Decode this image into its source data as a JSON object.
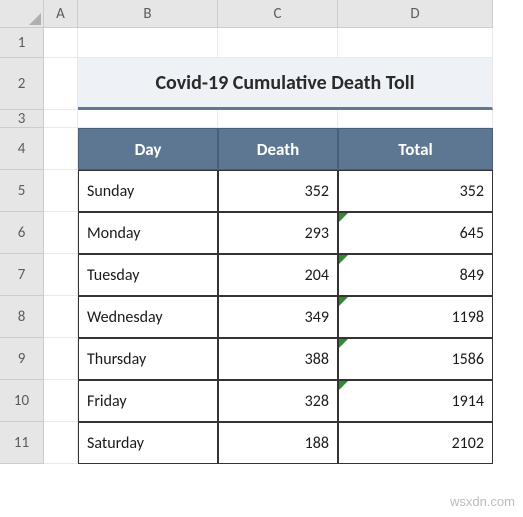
{
  "columns": [
    "",
    "A",
    "B",
    "C",
    "D"
  ],
  "rows": [
    "1",
    "2",
    "3",
    "4",
    "5",
    "6",
    "7",
    "8",
    "9",
    "10",
    "11"
  ],
  "title": "Covid-19 Cumulative Death Toll",
  "table": {
    "headers": {
      "day": "Day",
      "death": "Death",
      "total": "Total"
    },
    "data": [
      {
        "day": "Sunday",
        "death": "352",
        "total": "352",
        "err": false
      },
      {
        "day": "Monday",
        "death": "293",
        "total": "645",
        "err": true
      },
      {
        "day": "Tuesday",
        "death": "204",
        "total": "849",
        "err": true
      },
      {
        "day": "Wednesday",
        "death": "349",
        "total": "1198",
        "err": true
      },
      {
        "day": "Thursday",
        "death": "388",
        "total": "1586",
        "err": true
      },
      {
        "day": "Friday",
        "death": "328",
        "total": "1914",
        "err": true
      },
      {
        "day": "Saturday",
        "death": "188",
        "total": "2102",
        "err": false
      }
    ]
  },
  "watermark": "wsxdn.com",
  "chart_data": {
    "type": "table",
    "title": "Covid-19 Cumulative Death Toll",
    "headers": [
      "Day",
      "Death",
      "Total"
    ],
    "rows": [
      [
        "Sunday",
        352,
        352
      ],
      [
        "Monday",
        293,
        645
      ],
      [
        "Tuesday",
        204,
        849
      ],
      [
        "Wednesday",
        349,
        1198
      ],
      [
        "Thursday",
        388,
        1586
      ],
      [
        "Friday",
        328,
        1914
      ],
      [
        "Saturday",
        188,
        2102
      ]
    ]
  }
}
